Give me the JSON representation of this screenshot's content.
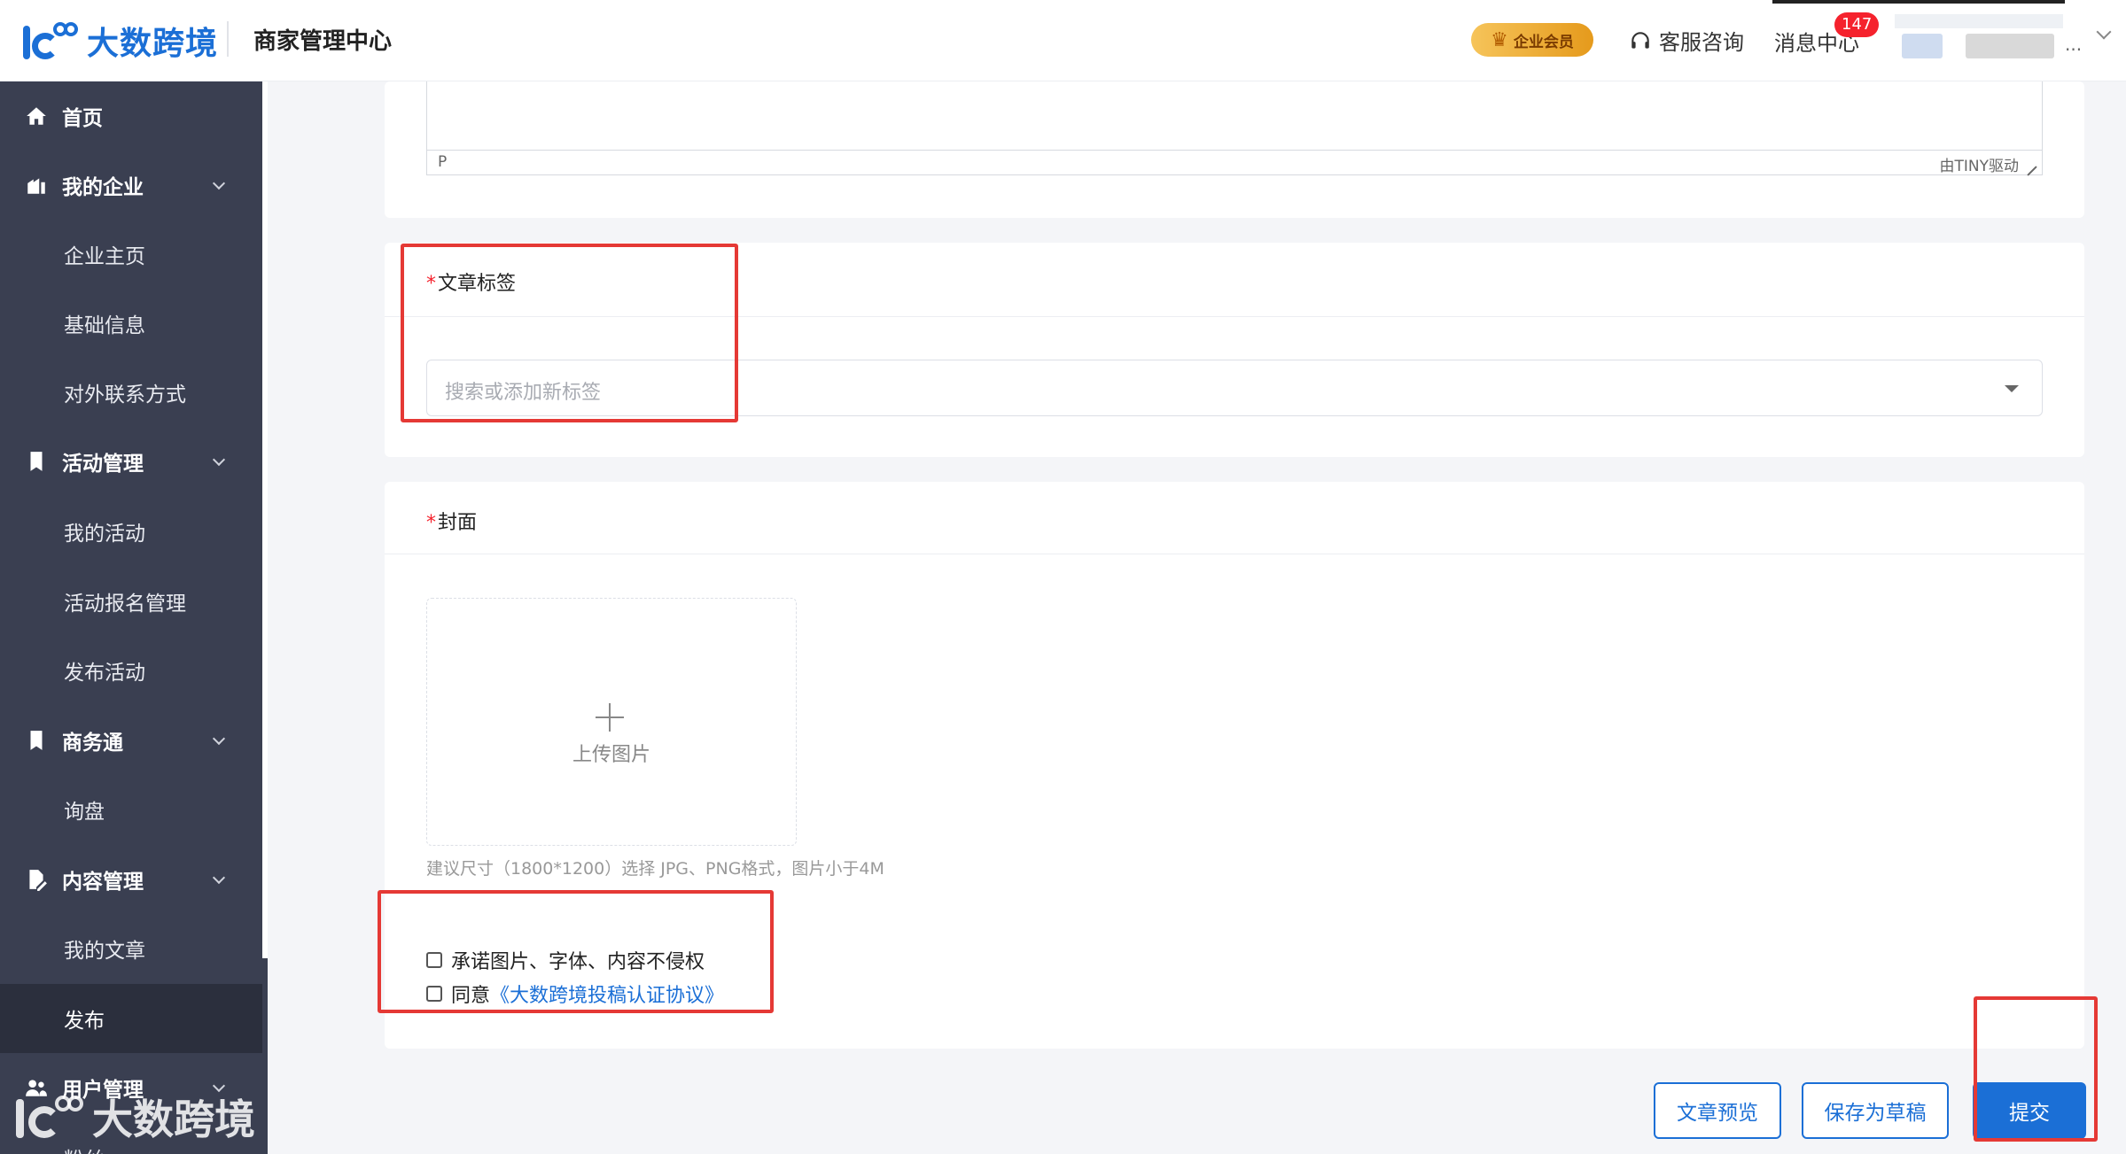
{
  "header": {
    "logo_text": "大数跨境",
    "title": "商家管理中心",
    "vip_label": "企业会员",
    "support_label": "客服咨询",
    "messages_label": "消息中心",
    "messages_count": "147",
    "user_ellipsis": "..."
  },
  "sidebar": {
    "items": [
      {
        "label": "首页",
        "type": "parent",
        "icon": "home-icon"
      },
      {
        "label": "我的企业",
        "type": "parent",
        "icon": "building-icon",
        "expandable": true
      },
      {
        "label": "企业主页",
        "type": "child"
      },
      {
        "label": "基础信息",
        "type": "child"
      },
      {
        "label": "对外联系方式",
        "type": "child"
      },
      {
        "label": "活动管理",
        "type": "parent",
        "icon": "bookmark-icon",
        "expandable": true
      },
      {
        "label": "我的活动",
        "type": "child"
      },
      {
        "label": "活动报名管理",
        "type": "child"
      },
      {
        "label": "发布活动",
        "type": "child"
      },
      {
        "label": "商务通",
        "type": "parent",
        "icon": "bookmark-icon",
        "expandable": true
      },
      {
        "label": "询盘",
        "type": "child"
      },
      {
        "label": "内容管理",
        "type": "parent",
        "icon": "document-edit-icon",
        "expandable": true
      },
      {
        "label": "我的文章",
        "type": "child"
      },
      {
        "label": "发布",
        "type": "child",
        "active": true
      },
      {
        "label": "用户管理",
        "type": "parent",
        "icon": "users-icon",
        "expandable": true
      },
      {
        "label": "粉丝",
        "type": "child"
      }
    ],
    "watermark_text": "大数跨境"
  },
  "editor": {
    "status_path": "P",
    "powered_by": "由TINY驱动"
  },
  "tags_section": {
    "label": "文章标签",
    "required_mark": "*",
    "placeholder": "搜索或添加新标签"
  },
  "cover_section": {
    "label": "封面",
    "required_mark": "*",
    "upload_label": "上传图片",
    "hint": "建议尺寸（1800*1200）选择 JPG、PNG格式，图片小于4M",
    "checkbox_1": "承诺图片、字体、内容不侵权",
    "checkbox_2_prefix": "同意",
    "checkbox_2_link": "《大数跨境投稿认证协议》"
  },
  "actions": {
    "preview": "文章预览",
    "save_draft": "保存为草稿",
    "submit": "提交"
  },
  "colors": {
    "brand": "#1b6fd6",
    "sidebar_bg": "#3a3f51",
    "sidebar_active": "#2b2f3d",
    "required": "#f5222d",
    "highlight": "#e53935",
    "badge": "#f5222d"
  }
}
